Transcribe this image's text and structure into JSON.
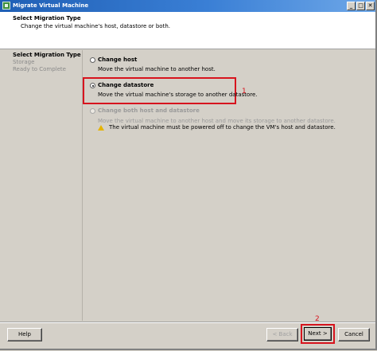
{
  "window": {
    "title": "Migrate Virtual Machine",
    "controls": [
      "_",
      "□",
      "✕"
    ]
  },
  "header": {
    "title": "Select Migration Type",
    "subtitle": "Change the virtual machine's host, datastore or both."
  },
  "steps": [
    {
      "label": "Select Migration Type",
      "active": true
    },
    {
      "label": "Storage",
      "active": false
    },
    {
      "label": "Ready to Complete",
      "active": false
    }
  ],
  "options": [
    {
      "label": "Change host",
      "description": "Move the virtual machine to another host.",
      "selected": false,
      "enabled": true
    },
    {
      "label": "Change datastore",
      "description": "Move the virtual machine's storage to another datastore.",
      "selected": true,
      "enabled": true
    },
    {
      "label": "Change both host and datastore",
      "description": "Move the virtual machine to another host and move its storage to another datastore.",
      "selected": false,
      "enabled": false,
      "warning": "The virtual machine must be powered off to change the VM's host and datastore."
    }
  ],
  "annotations": {
    "marker1": "1",
    "marker2": "2"
  },
  "buttons": {
    "help": "Help",
    "back": "< Back",
    "next": "Next >",
    "cancel": "Cancel"
  },
  "colors": {
    "title_bar": "#1f5fb5",
    "annotation_red": "#d7141e",
    "dialog_bg": "#d4d0c8",
    "warning_icon": "#e5b400"
  },
  "icons": [
    "vm-app-icon",
    "minimize-icon",
    "maximize-icon",
    "close-icon",
    "warning-icon"
  ]
}
